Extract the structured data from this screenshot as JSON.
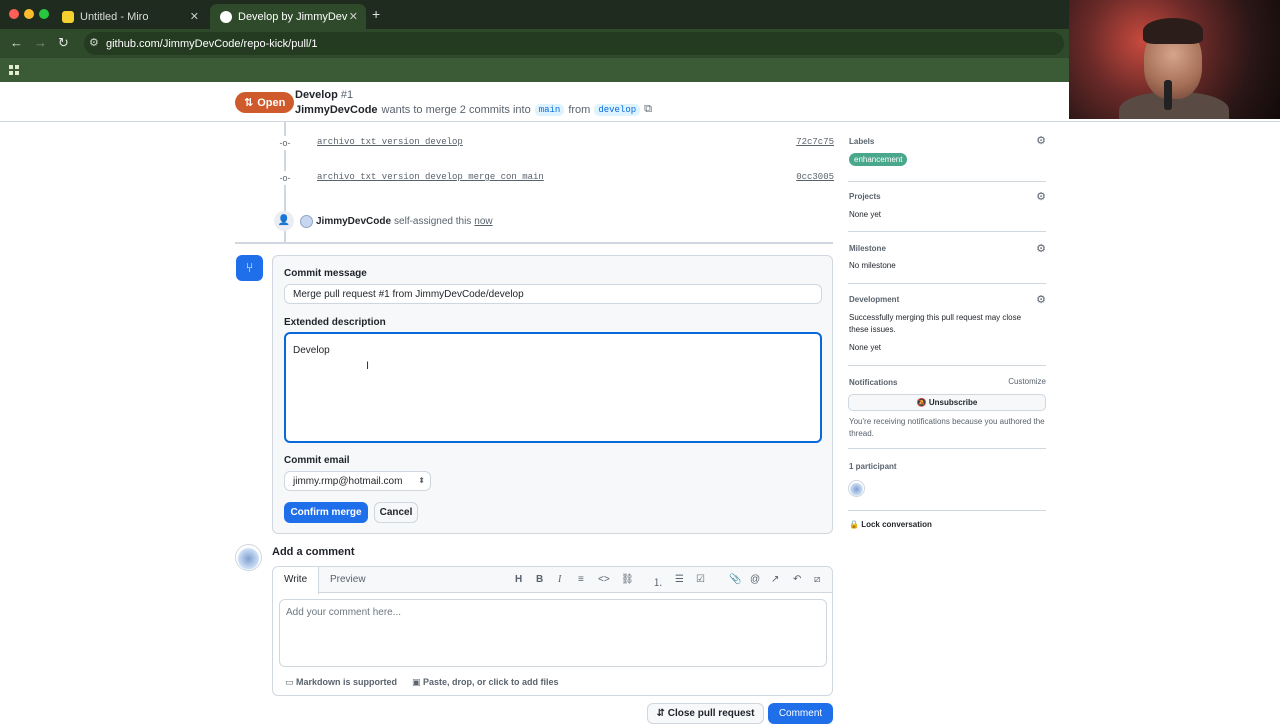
{
  "browser": {
    "tabs": [
      {
        "label": "Untitled - Miro",
        "active": false,
        "favicon_color": "#f5d130"
      },
      {
        "label": "Develop by JimmyDevCode",
        "active": true,
        "favicon_color": "#ffffff"
      }
    ],
    "url": "github.com/JimmyDevCode/repo-kick/pull/1"
  },
  "pr": {
    "status": "Open",
    "title": "Develop",
    "number": "#1",
    "author": "JimmyDevCode",
    "merge_text": "wants to merge 2 commits into",
    "base_branch": "main",
    "from_text": "from",
    "head_branch": "develop"
  },
  "timeline": {
    "commits": [
      {
        "message": "archivo txt version develop",
        "sha": "72c7c75"
      },
      {
        "message": "archivo txt version develop merge con main",
        "sha": "0cc3005"
      }
    ],
    "assign_event": {
      "user": "JimmyDevCode",
      "action": "self-assigned this",
      "time": "now"
    }
  },
  "merge_form": {
    "commit_message_label": "Commit message",
    "commit_message_value": "Merge pull request #1 from JimmyDevCode/develop",
    "extended_label": "Extended description",
    "extended_value": "Develop",
    "email_label": "Commit email",
    "email_value": "jimmy.rmp@hotmail.com",
    "confirm_label": "Confirm merge",
    "cancel_label": "Cancel"
  },
  "comment": {
    "title": "Add a comment",
    "tab_write": "Write",
    "tab_preview": "Preview",
    "placeholder": "Add your comment here...",
    "markdown_note": "Markdown is supported",
    "attach_note": "Paste, drop, or click to add files",
    "close_pr_label": "Close pull request",
    "comment_label": "Comment"
  },
  "sidebar": {
    "labels_head": "Labels",
    "label_value": "enhancement",
    "projects_head": "Projects",
    "projects_value": "None yet",
    "milestone_head": "Milestone",
    "milestone_value": "No milestone",
    "development_head": "Development",
    "development_desc": "Successfully merging this pull request may close these issues.",
    "development_value": "None yet",
    "notifications_head": "Notifications",
    "customize": "Customize",
    "unsubscribe": "Unsubscribe",
    "notif_reason": "You're receiving notifications because you authored the thread.",
    "participants_head": "1 participant",
    "lock": "Lock conversation"
  }
}
